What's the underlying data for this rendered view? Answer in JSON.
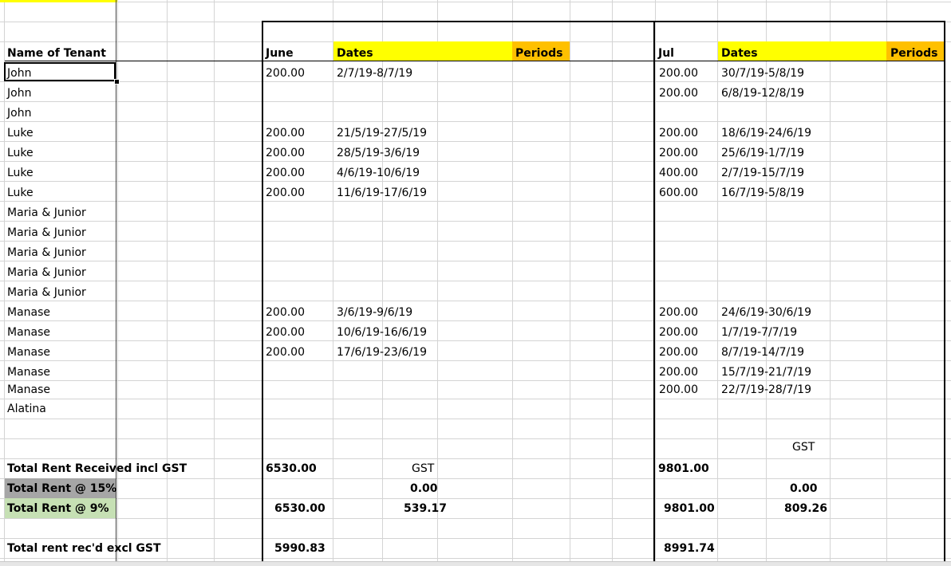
{
  "header": {
    "name_of_tenant": "Name of Tenant",
    "june": "June",
    "dates_a": "Dates",
    "periods_a": "Periods",
    "jul": "Jul",
    "dates_b": "Dates",
    "periods_b": "Periods"
  },
  "rows": [
    {
      "name": "John",
      "june": "200.00",
      "june_dates": "2/7/19-8/7/19",
      "jul": "200.00",
      "jul_dates": "30/7/19-5/8/19"
    },
    {
      "name": "John",
      "june": "",
      "june_dates": "",
      "jul": "200.00",
      "jul_dates": "6/8/19-12/8/19"
    },
    {
      "name": "John",
      "june": "",
      "june_dates": "",
      "jul": "",
      "jul_dates": ""
    },
    {
      "name": "Luke",
      "june": "200.00",
      "june_dates": "21/5/19-27/5/19",
      "jul": "200.00",
      "jul_dates": "18/6/19-24/6/19"
    },
    {
      "name": "Luke",
      "june": "200.00",
      "june_dates": "28/5/19-3/6/19",
      "jul": "200.00",
      "jul_dates": "25/6/19-1/7/19"
    },
    {
      "name": "Luke",
      "june": "200.00",
      "june_dates": "4/6/19-10/6/19",
      "jul": "400.00",
      "jul_dates": "2/7/19-15/7/19"
    },
    {
      "name": "Luke",
      "june": "200.00",
      "june_dates": "11/6/19-17/6/19",
      "jul": "600.00",
      "jul_dates": "16/7/19-5/8/19"
    },
    {
      "name": "Maria & Junior",
      "june": "",
      "june_dates": "",
      "jul": "",
      "jul_dates": ""
    },
    {
      "name": "Maria & Junior",
      "june": "",
      "june_dates": "",
      "jul": "",
      "jul_dates": ""
    },
    {
      "name": "Maria & Junior",
      "june": "",
      "june_dates": "",
      "jul": "",
      "jul_dates": ""
    },
    {
      "name": "Maria & Junior",
      "june": "",
      "june_dates": "",
      "jul": "",
      "jul_dates": ""
    },
    {
      "name": "Maria & Junior",
      "june": "",
      "june_dates": "",
      "jul": "",
      "jul_dates": ""
    },
    {
      "name": "Manase",
      "june": "200.00",
      "june_dates": "3/6/19-9/6/19",
      "jul": "200.00",
      "jul_dates": "24/6/19-30/6/19"
    },
    {
      "name": "Manase",
      "june": "200.00",
      "june_dates": "10/6/19-16/6/19",
      "jul": "200.00",
      "jul_dates": "1/7/19-7/7/19"
    },
    {
      "name": "Manase",
      "june": "200.00",
      "june_dates": "17/6/19-23/6/19",
      "jul": "200.00",
      "jul_dates": "8/7/19-14/7/19"
    },
    {
      "name": "Manase",
      "june": "",
      "june_dates": "",
      "jul": "200.00",
      "jul_dates": "15/7/19-21/7/19"
    },
    {
      "name": "Manase",
      "june": "",
      "june_dates": "",
      "jul": "200.00",
      "jul_dates": "22/7/19-28/7/19"
    },
    {
      "name": "Alatina",
      "june": "",
      "june_dates": "",
      "jul": "",
      "jul_dates": ""
    }
  ],
  "summary": {
    "gst_label_jul": "GST",
    "total_received_label": "Total Rent Received incl GST",
    "total_received_june": "6530.00",
    "gst_label_june": "GST",
    "total_received_jul": "9801.00",
    "rent15_label": "Total Rent @ 15%",
    "rent15_gst_june": "0.00",
    "rent15_gst_jul": "0.00",
    "rent9_label": "Total Rent @ 9%",
    "rent9_june": "6530.00",
    "rent9_gst_june": "539.17",
    "rent9_jul": "9801.00",
    "rent9_gst_jul": "809.26",
    "excl_label": "Total rent rec'd excl GST",
    "excl_june": "5990.83",
    "excl_jul": "8991.74"
  },
  "colors": {
    "yellow": "#ffff00",
    "orange": "#ffc000",
    "gray": "#a6a6a6",
    "green": "#c6e0b4",
    "gridline": "#d4d4d4"
  }
}
